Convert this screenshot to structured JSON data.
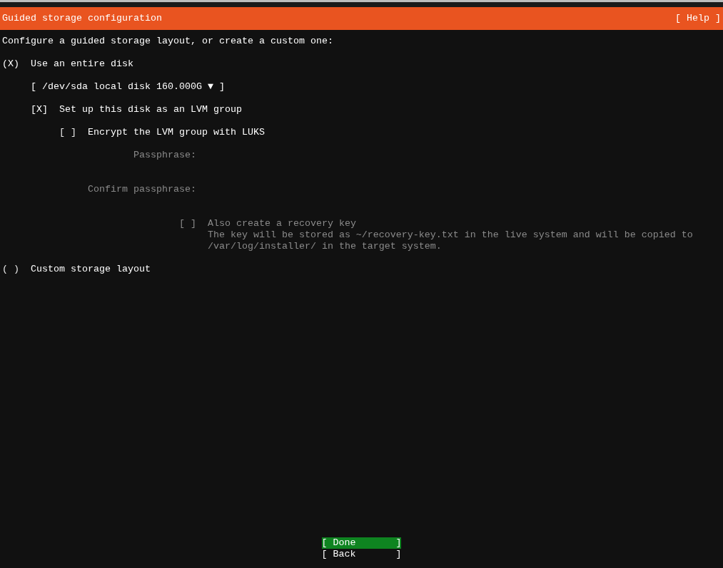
{
  "header": {
    "title": "Guided storage configuration",
    "help": "[ Help ]"
  },
  "intro": "Configure a guided storage layout, or create a custom one:",
  "entire_disk": {
    "mark": "(X)",
    "label": "Use an entire disk",
    "selected": true
  },
  "disk_select": {
    "text": "[ /dev/sda local disk 160.000G ▼ ]"
  },
  "lvm": {
    "mark": "[X]",
    "label": "Set up this disk as an LVM group",
    "checked": true
  },
  "encrypt": {
    "mark": "[ ]",
    "label": "Encrypt the LVM group with LUKS",
    "checked": false
  },
  "passphrase": {
    "label": "Passphrase:",
    "disabled": true
  },
  "confirm_passphrase": {
    "label": "Confirm passphrase:",
    "disabled": true
  },
  "recovery_key": {
    "mark": "[ ]",
    "label": "Also create a recovery key",
    "checked": false,
    "disabled": true,
    "help": [
      "The key will be stored as ~/recovery-key.txt in the live system and will be copied to",
      "/var/log/installer/ in the target system."
    ]
  },
  "custom_layout": {
    "mark": "( )",
    "label": "Custom storage layout",
    "selected": false
  },
  "buttons": [
    {
      "left": "[ Done",
      "right": "]",
      "selected": true
    },
    {
      "left": "[ Back",
      "right": "]",
      "selected": false
    }
  ]
}
